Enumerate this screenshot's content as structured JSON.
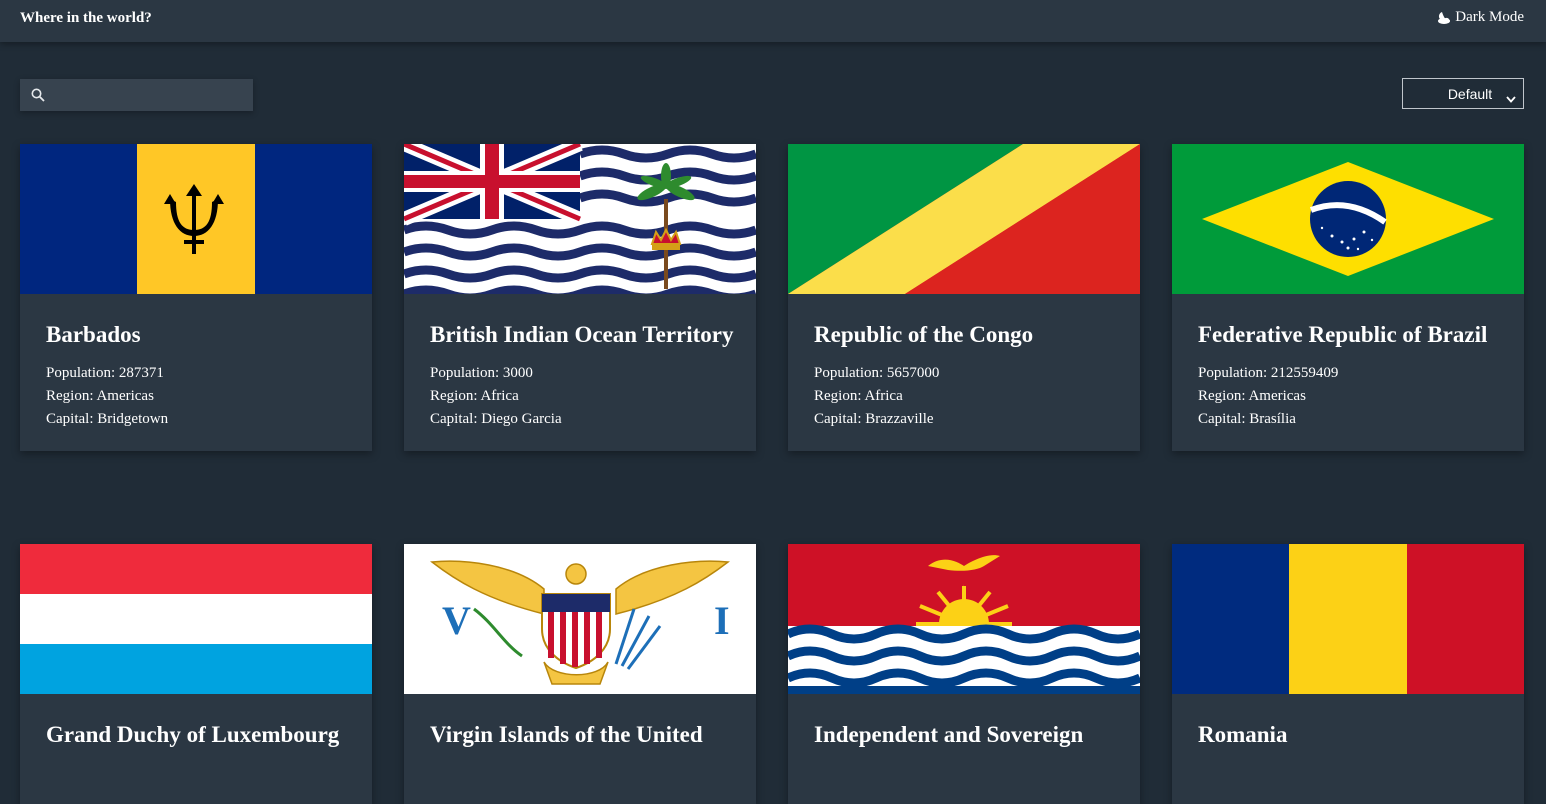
{
  "header": {
    "title": "Where in the world?",
    "dark_mode_label": "Dark Mode",
    "dark_mode_icon": "moon-icon"
  },
  "toolbar": {
    "search_placeholder": "",
    "search_value": "",
    "search_icon": "search-icon",
    "filter_selected": "Default"
  },
  "colors": {
    "background": "#202c37",
    "surface": "#2b3743",
    "text": "#ffffff"
  },
  "countries": [
    {
      "name": "Barbados",
      "population_label": "Population:",
      "population": "287371",
      "region_label": "Region:",
      "region": "Americas",
      "capital_label": "Capital:",
      "capital": "Bridgetown"
    },
    {
      "name": "British Indian Ocean Territory",
      "population_label": "Population:",
      "population": "3000",
      "region_label": "Region:",
      "region": "Africa",
      "capital_label": "Capital:",
      "capital": "Diego Garcia"
    },
    {
      "name": "Republic of the Congo",
      "population_label": "Population:",
      "population": "5657000",
      "region_label": "Region:",
      "region": "Africa",
      "capital_label": "Capital:",
      "capital": "Brazzaville"
    },
    {
      "name": "Federative Republic of Brazil",
      "population_label": "Population:",
      "population": "212559409",
      "region_label": "Region:",
      "region": "Americas",
      "capital_label": "Capital:",
      "capital": "Brasília"
    },
    {
      "name": "Grand Duchy of Luxembourg"
    },
    {
      "name": "Virgin Islands of the United"
    },
    {
      "name": "Independent and Sovereign"
    },
    {
      "name": "Romania"
    }
  ]
}
